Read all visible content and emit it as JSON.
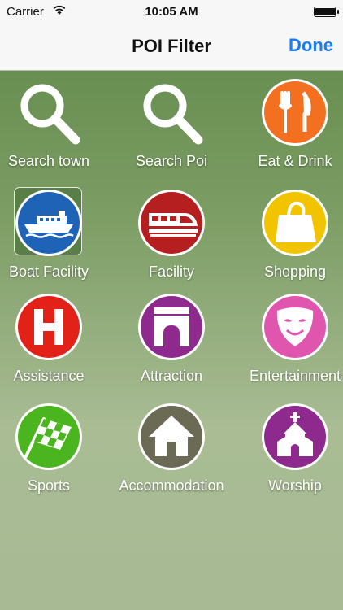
{
  "status_bar": {
    "carrier": "Carrier",
    "time": "10:05 AM",
    "battery_level": 0.95
  },
  "nav": {
    "title": "POI Filter",
    "done_label": "Done"
  },
  "tiles": [
    {
      "label": "Search town",
      "icon": "magnifier-icon",
      "color": "#ffffff"
    },
    {
      "label": "Search Poi",
      "icon": "magnifier-icon",
      "color": "#ffffff"
    },
    {
      "label": "Eat & Drink",
      "icon": "fork-knife-icon",
      "color": "#f37021"
    },
    {
      "label": "Boat Facility",
      "icon": "boat-icon",
      "color": "#1e63b6",
      "selected": true
    },
    {
      "label": "Facility",
      "icon": "train-icon",
      "color": "#b51f1f"
    },
    {
      "label": "Shopping",
      "icon": "shopping-bag-icon",
      "color": "#f2c400"
    },
    {
      "label": "Assistance",
      "icon": "hospital-h-icon",
      "color": "#e22219"
    },
    {
      "label": "Attraction",
      "icon": "arch-icon",
      "color": "#8e2a8e"
    },
    {
      "label": "Entertainment",
      "icon": "theater-mask-icon",
      "color": "#e056ae"
    },
    {
      "label": "Sports",
      "icon": "checkered-flag-icon",
      "color": "#4bb51f"
    },
    {
      "label": "Accommodation",
      "icon": "house-icon",
      "color": "#6b6b55"
    },
    {
      "label": "Worship",
      "icon": "church-icon",
      "color": "#8e2a8e"
    }
  ]
}
